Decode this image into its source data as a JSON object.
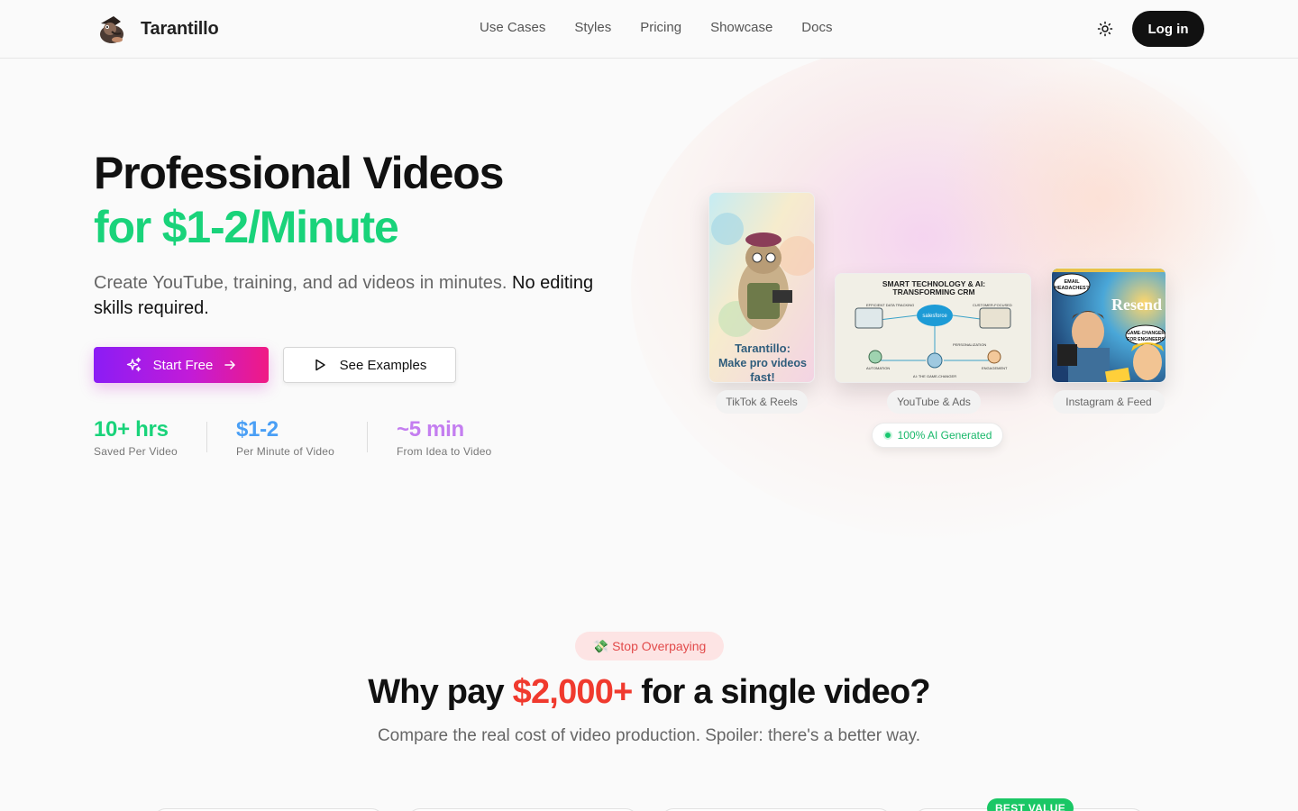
{
  "brand": {
    "name": "Tarantillo"
  },
  "nav": {
    "links": [
      "Use Cases",
      "Styles",
      "Pricing",
      "Showcase",
      "Docs"
    ],
    "login_label": "Log in"
  },
  "hero": {
    "title_line1": "Professional Videos",
    "title_line2": "for $1-2/Minute",
    "subtitle_plain": "Create YouTube, training, and ad videos in minutes.",
    "subtitle_strong": "No editing skills required.",
    "start_label": "Start Free",
    "examples_label": "See Examples",
    "stats": [
      {
        "value": "10+ hrs",
        "label": "Saved Per Video",
        "color": "#19d37a"
      },
      {
        "value": "$1-2",
        "label": "Per Minute of Video",
        "color": "#4a9ff5"
      },
      {
        "value": "~5 min",
        "label": "From Idea to Video",
        "color": "#c47ef0"
      }
    ]
  },
  "cards": {
    "tiktok": {
      "label": "TikTok & Reels",
      "caption": "Tarantillo: Make pro videos fast!"
    },
    "youtube": {
      "label": "YouTube & Ads",
      "caption": "SMART TECHNOLOGY & AI: TRANSFORMING CRM",
      "nodes": [
        "EFFICIENT DATA TRACKING",
        "salesforce",
        "CUSTOMER-FOCUSED",
        "AUTOMATION",
        "PERSONALIZATION",
        "ENGAGEMENT",
        "AI: THE GAME-CHANGER"
      ]
    },
    "instagram": {
      "label": "Instagram & Feed",
      "bubble1": "EMAIL HEADACHES?",
      "brand_text": "Resend",
      "bubble2": "GAME-CHANGER FOR ENGINEERS"
    },
    "ai_badge": "100% AI Generated"
  },
  "section2": {
    "pill_emoji": "💸",
    "pill_text": "Stop Overpaying",
    "heading_pre": "Why pay",
    "heading_price": "$2,000+",
    "heading_post": "for a single video?",
    "subheading": "Compare the real cost of video production. Spoiler: there's a better way.",
    "best_value": "BEST VALUE"
  },
  "colors": {
    "accent_green": "#19d37a",
    "brand_dark": "#111111",
    "price_red": "#f03a2e"
  }
}
